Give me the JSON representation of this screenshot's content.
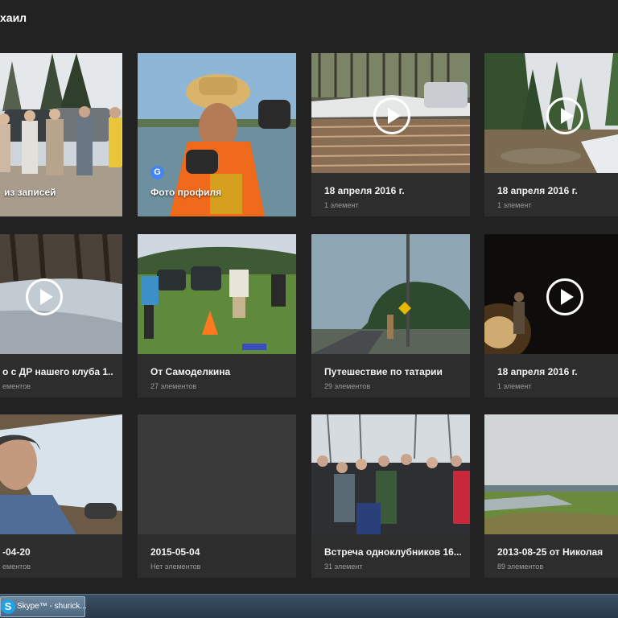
{
  "header": {
    "title": "хаил"
  },
  "cards": [
    {
      "title": "из записей",
      "sub": ""
    },
    {
      "title": "Фото профиля",
      "sub": ""
    },
    {
      "title": "18 апреля 2016 г.",
      "sub": "1 элемент"
    },
    {
      "title": "18 апреля 2016 г.",
      "sub": "1 элемент"
    },
    {
      "title": "о с ДР нашего клуба 1..",
      "sub": "ементов"
    },
    {
      "title": "От Самоделкина",
      "sub": "27 элементов"
    },
    {
      "title": "Путешествие по татарии",
      "sub": "29 элементов"
    },
    {
      "title": "18 апреля 2016 г.",
      "sub": "1 элемент"
    },
    {
      "title": "-04-20",
      "sub": "ементов"
    },
    {
      "title": "2015-05-04",
      "sub": "Нет элементов"
    },
    {
      "title": "Встреча одноклубников 16...",
      "sub": "31 элемент"
    },
    {
      "title": "2013-08-25 от Николая",
      "sub": "89 элементов"
    }
  ],
  "taskbar": {
    "skype_label": "Skype™ - shurick..."
  },
  "icons": {
    "play": "play-icon",
    "google": "google-icon",
    "skype": "skype-icon"
  },
  "colors": {
    "background": "#222222",
    "card": "#2d2d2d",
    "text": "#f2f2f2",
    "subtext": "#9b9b9b"
  }
}
